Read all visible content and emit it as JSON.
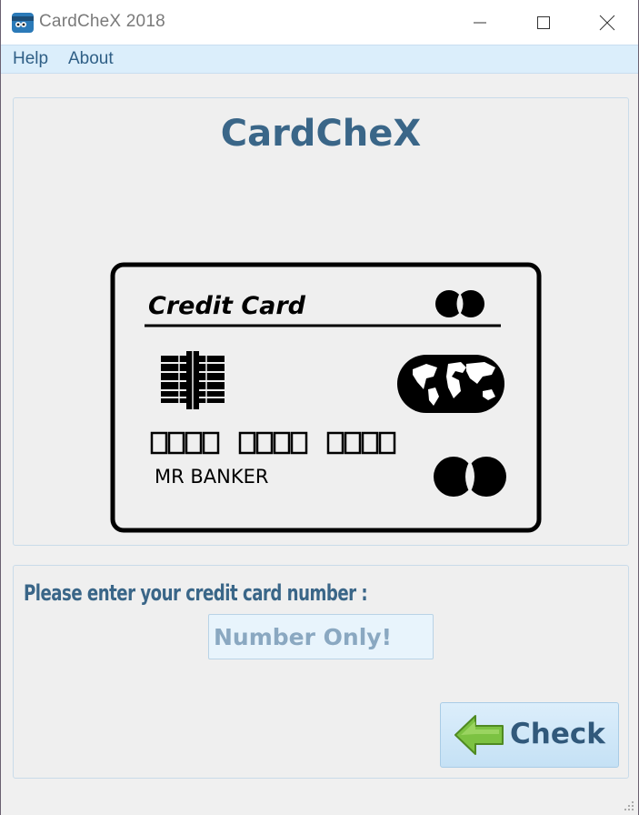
{
  "window": {
    "title": "CardCheX 2018"
  },
  "menu": {
    "help_label": "Help",
    "about_label": "About"
  },
  "header": {
    "app_title": "CardCheX"
  },
  "card": {
    "label": "Credit Card",
    "number_groups": [
      "",
      "",
      ""
    ],
    "holder_name": "MR BANKER"
  },
  "form": {
    "prompt": "Please enter your credit card number :",
    "input_placeholder": "Number Only!",
    "input_value": "",
    "check_label": "Check"
  },
  "colors": {
    "accent": "#3a6688",
    "menu_bg": "#dbeefb",
    "arrow_green": "#7cc242"
  },
  "icons": {
    "app": "credit-card-icon",
    "minimize": "minimize-icon",
    "maximize": "maximize-icon",
    "close": "close-icon",
    "check": "green-arrow-left-icon"
  }
}
